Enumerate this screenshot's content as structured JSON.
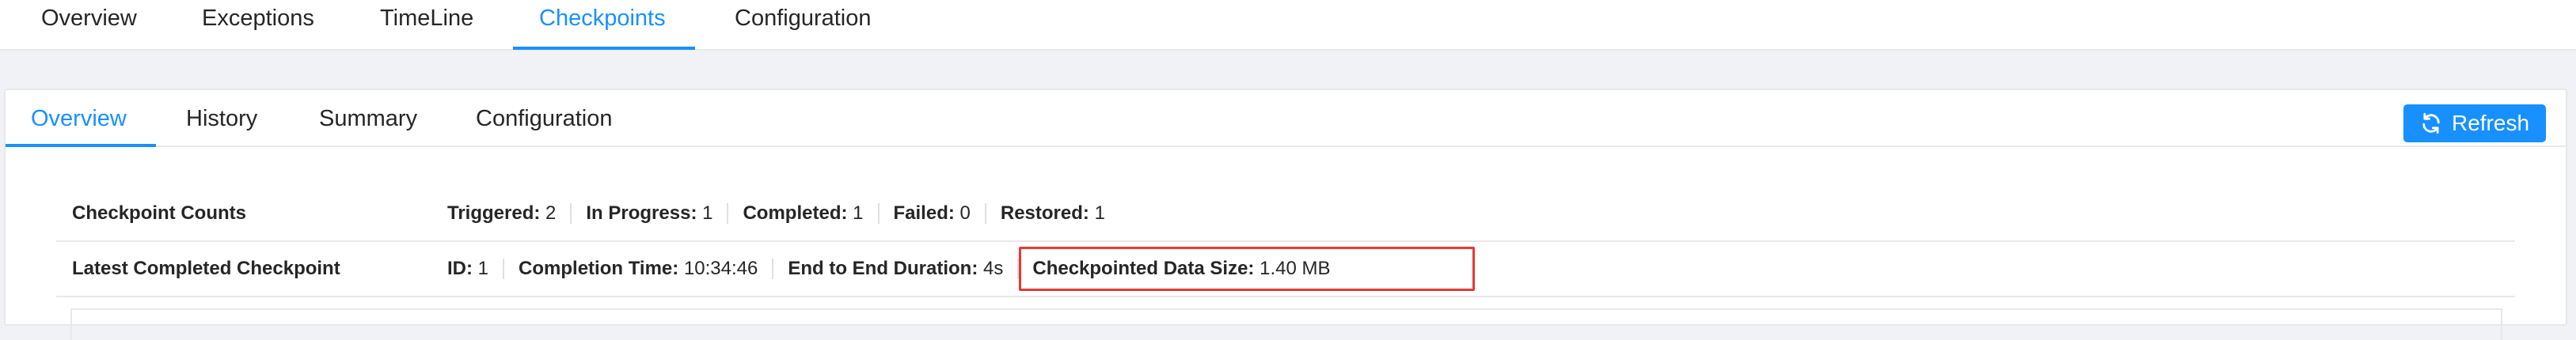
{
  "top_tabs": {
    "overview": "Overview",
    "exceptions": "Exceptions",
    "timeline": "TimeLine",
    "checkpoints": "Checkpoints",
    "configuration": "Configuration"
  },
  "sub_tabs": {
    "overview": "Overview",
    "history": "History",
    "summary": "Summary",
    "configuration": "Configuration"
  },
  "refresh": {
    "label": "Refresh",
    "icon": "refresh-icon"
  },
  "checkpoint_counts": {
    "label": "Checkpoint Counts",
    "triggered_label": "Triggered:",
    "triggered_value": "2",
    "in_progress_label": "In Progress:",
    "in_progress_value": "1",
    "completed_label": "Completed:",
    "completed_value": "1",
    "failed_label": "Failed:",
    "failed_value": "0",
    "restored_label": "Restored:",
    "restored_value": "1"
  },
  "latest_completed": {
    "label": "Latest Completed Checkpoint",
    "id_label": "ID:",
    "id_value": "1",
    "completion_time_label": "Completion Time:",
    "completion_time_value": "10:34:46",
    "duration_label": "End to End Duration:",
    "duration_value": "4s",
    "data_size_label": "Checkpointed Data Size:",
    "data_size_value": "1.40 MB"
  },
  "colors": {
    "accent": "#1890ff",
    "highlight_border": "#e53935"
  }
}
